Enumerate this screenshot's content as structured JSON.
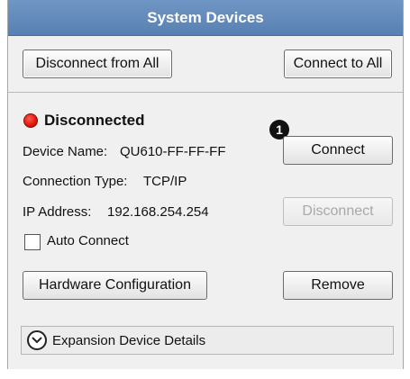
{
  "window": {
    "title": "System Devices"
  },
  "toolbar": {
    "disconnect_all_label": "Disconnect from All",
    "connect_all_label": "Connect to All"
  },
  "device": {
    "status_text": "Disconnected",
    "status_color": "#e0140a",
    "name_label": "Device Name:",
    "name_value": "QU610-FF-FF-FF",
    "conn_type_label": "Connection Type:",
    "conn_type_value": "TCP/IP",
    "ip_label": "IP Address:",
    "ip_value": "192.168.254.254",
    "auto_connect_label": "Auto Connect",
    "auto_connect_checked": false
  },
  "buttons": {
    "connect_label": "Connect",
    "disconnect_label": "Disconnect",
    "hardware_config_label": "Hardware Configuration",
    "remove_label": "Remove"
  },
  "callout": {
    "number": "1"
  },
  "expansion": {
    "label": "Expansion Device Details",
    "icon": "chevron-down-icon"
  }
}
